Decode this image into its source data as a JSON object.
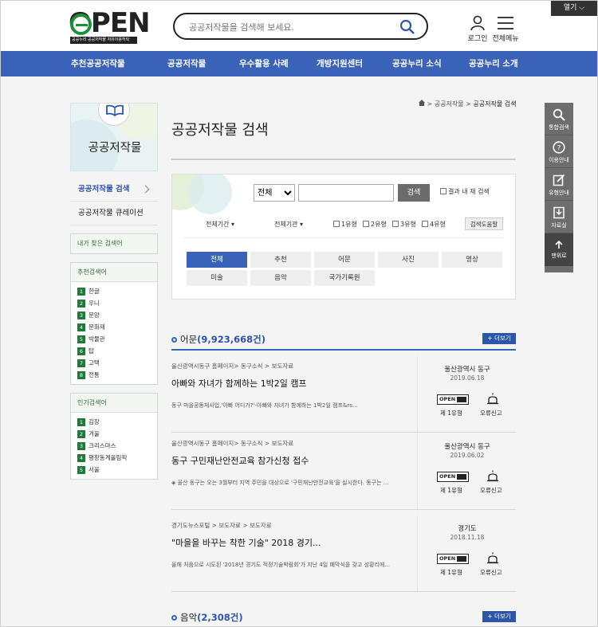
{
  "header": {
    "logo_text": "OPEN",
    "logo_sub": "공공누리 공공저작물 자유이용허락",
    "search_placeholder": "공공저작물을 검색해 보세요.",
    "login_label": "로그인",
    "menu_label": "전체메뉴",
    "open_label": "열기"
  },
  "nav": [
    "추천공공저작물",
    "공공저작물",
    "우수활용 사례",
    "개방지원센터",
    "공공누리 소식",
    "공공누리 소개"
  ],
  "sidebar": {
    "title": "공공저작물",
    "menu": [
      "공공저작물 검색",
      "공공저작물 큐레이션"
    ],
    "my_keywords_label": "내가 찾은 검색어",
    "recommended_label": "추천검색어",
    "recommended": [
      "한글",
      "우니",
      "문양",
      "문화재",
      "박물관",
      "탑",
      "고택",
      "전통"
    ],
    "popular_label": "인기검색어",
    "popular": [
      "김장",
      "겨울",
      "크리스마스",
      "평창동계올림픽",
      "서울"
    ]
  },
  "breadcrumb": {
    "home": "home-icon",
    "level1": "공공저작물",
    "current": "공공저작물 검색",
    "separator": ">"
  },
  "page_title": "공공저작물 검색",
  "filter": {
    "scope_value": "전체",
    "search_button": "검색",
    "within_label": "결과 내 재 검색",
    "period_label": "전체기간",
    "org_label": "전체기관",
    "types": [
      "1유형",
      "2유형",
      "3유형",
      "4유형"
    ],
    "help_label": "검색도움말",
    "categories": [
      "전체",
      "추천",
      "어문",
      "사진",
      "영상",
      "미술",
      "음악",
      "국가기록원"
    ]
  },
  "sections": [
    {
      "title": "어문",
      "count": "(9,923,668건)",
      "more_label": "+ 더보기",
      "items": [
        {
          "source": "울산광역시동구 홈페이지> 동구소식 > 보도자료",
          "title": "아빠와 자녀가 함께하는 1박2일 캠프",
          "desc": "동구 마을공동체사업,'아빠 어디가?'-아빠와 자녀가 함께하는 1박2일 캠프&rs...",
          "org": "울산광역시 동구",
          "date": "2019.06.18",
          "type": "제 1유형",
          "report": "오류신고"
        },
        {
          "source": "울산광역시동구 홈페이지> 동구소식 > 보도자료",
          "title": "동구 구민재난안전교육 참가신청 접수",
          "desc": "◈ 울산 동구는 오는 3월부터 지역 주민을 대상으로 '구민재난안전교육'을 실시한다. 동구는 ...",
          "org": "울산광역시 동구",
          "date": "2019.06.02",
          "type": "제 1유형",
          "report": "오류신고"
        },
        {
          "source": "경기도뉴스포털 > 보도자료 > 보도자료",
          "title": "\"마을을 바꾸는 착한 기술\" 2018 경기...",
          "desc": "올해 처음으로 시도된 '2018년 경기도 적정기술박람회'가 지난 4일 폐막식을 갖고 성황리에...",
          "org": "경기도",
          "date": "2018.11.18",
          "type": "제 1유형",
          "report": "오류신고"
        }
      ]
    },
    {
      "title": "음악",
      "count": "(2,308건)",
      "more_label": "+ 더보기"
    }
  ],
  "quick_menu": [
    "통합검색",
    "이용안내",
    "유형안내",
    "자료실",
    "맨위로"
  ],
  "colors": {
    "nav_bg": "#3a63b8",
    "accent": "#2d56a9",
    "quick_bg": "#6d6d6d"
  }
}
